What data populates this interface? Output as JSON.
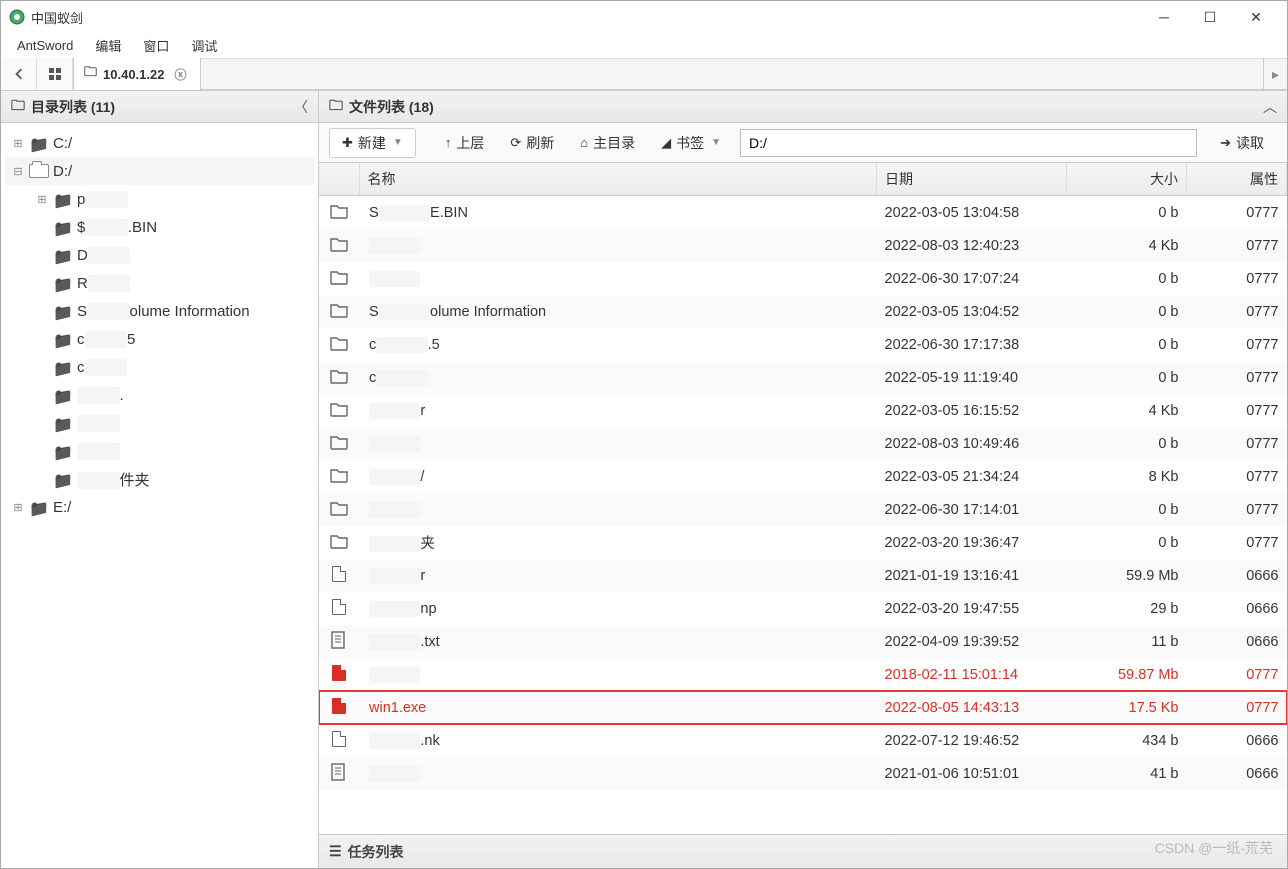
{
  "window": {
    "title": "中国蚁剑"
  },
  "menubar": {
    "items": [
      "AntSword",
      "编辑",
      "窗口",
      "调试"
    ]
  },
  "tabbar": {
    "active_tab": "10.40.1.22"
  },
  "sidebar": {
    "title": "目录列表 (11)",
    "tree": [
      {
        "label": "C:/",
        "icon": "dark",
        "depth": 0
      },
      {
        "label": "D:/",
        "icon": "open",
        "depth": 0,
        "expanded": true,
        "selected": true
      },
      {
        "label": "p███",
        "visible": "p",
        "depth": 1,
        "expandable": true
      },
      {
        "label": "$█████.BIN",
        "visible": "$",
        "tail": ".BIN",
        "depth": 1
      },
      {
        "label": "D███",
        "visible": "D",
        "depth": 1
      },
      {
        "label": "R███",
        "visible": "R",
        "depth": 1
      },
      {
        "label": "S███ Volume Information",
        "visible": "S",
        "tail": "olume Information",
        "depth": 1
      },
      {
        "label": "c████5",
        "visible": "c",
        "tail": "5",
        "depth": 1
      },
      {
        "label": "c███",
        "visible": "c",
        "depth": 1
      },
      {
        "label": "█████.",
        "tail": ".",
        "depth": 1
      },
      {
        "label": "████",
        "depth": 1
      },
      {
        "label": "████",
        "depth": 1
      },
      {
        "label": "███件夹",
        "tail": "件夹",
        "depth": 1
      },
      {
        "label": "E:/",
        "icon": "dark",
        "depth": 0
      }
    ]
  },
  "content": {
    "panel_title": "文件列表 (18)",
    "toolbar": {
      "new": "新建",
      "up": "上层",
      "refresh": "刷新",
      "home": "主目录",
      "bookmark": "书签",
      "path": "D:/",
      "read": "读取"
    },
    "columns": {
      "name": "名称",
      "date": "日期",
      "size": "大小",
      "attr": "属性"
    },
    "rows": [
      {
        "icon": "folder",
        "name": "S███E.BIN",
        "visible": "S",
        "tail": "E.BIN",
        "date": "2022-03-05 13:04:58",
        "size": "0 b",
        "attr": "0777"
      },
      {
        "icon": "folder",
        "name": "████",
        "date": "2022-08-03 12:40:23",
        "size": "4 Kb",
        "attr": "0777",
        "alt": true
      },
      {
        "icon": "folder",
        "name": "████",
        "date": "2022-06-30 17:07:24",
        "size": "0 b",
        "attr": "0777"
      },
      {
        "icon": "folder",
        "name": "S███olume Information",
        "visible": "S",
        "tail": "olume Information",
        "date": "2022-03-05 13:04:52",
        "size": "0 b",
        "attr": "0777",
        "alt": true
      },
      {
        "icon": "folder",
        "name": "c████.5",
        "visible": "c",
        "tail": ".5",
        "date": "2022-06-30 17:17:38",
        "size": "0 b",
        "attr": "0777"
      },
      {
        "icon": "folder",
        "name": "c███",
        "visible": "c",
        "date": "2022-05-19 11:19:40",
        "size": "0 b",
        "attr": "0777",
        "alt": true
      },
      {
        "icon": "folder",
        "name": "████",
        "tail": "r",
        "date": "2022-03-05 16:15:52",
        "size": "4 Kb",
        "attr": "0777"
      },
      {
        "icon": "folder",
        "name": "████",
        "date": "2022-08-03 10:49:46",
        "size": "0 b",
        "attr": "0777",
        "alt": true
      },
      {
        "icon": "folder",
        "name": "████/",
        "tail": "/",
        "date": "2022-03-05 21:34:24",
        "size": "8 Kb",
        "attr": "0777"
      },
      {
        "icon": "folder",
        "name": "████",
        "date": "2022-06-30 17:14:01",
        "size": "0 b",
        "attr": "0777",
        "alt": true
      },
      {
        "icon": "folder",
        "name": "████夹",
        "tail": "夹",
        "date": "2022-03-20 19:36:47",
        "size": "0 b",
        "attr": "0777"
      },
      {
        "icon": "zip",
        "name": "████r",
        "tail": "r",
        "date": "2021-01-19 13:16:41",
        "size": "59.9 Mb",
        "attr": "0666",
        "alt": true
      },
      {
        "icon": "code",
        "name": "████np",
        "tail": "np",
        "date": "2022-03-20 19:47:55",
        "size": "29 b",
        "attr": "0666"
      },
      {
        "icon": "text",
        "name": "████.txt",
        "tail": ".txt",
        "date": "2022-04-09 19:39:52",
        "size": "11 b",
        "attr": "0666",
        "alt": true
      },
      {
        "icon": "file-red",
        "name": "████████",
        "date": "2018-02-11 15:01:14",
        "size": "59.87 Mb",
        "attr": "0777",
        "danger": true
      },
      {
        "icon": "file-red",
        "name": "win1.exe",
        "full": true,
        "date": "2022-08-05 14:43:13",
        "size": "17.5 Kb",
        "attr": "0777",
        "danger": true,
        "boxed": true,
        "alt": true
      },
      {
        "icon": "file",
        "name": "██████████.nk",
        "tail": ".nk",
        "date": "2022-07-12 19:46:52",
        "size": "434 b",
        "attr": "0666"
      },
      {
        "icon": "text",
        "name": "██████",
        "date": "2021-01-06 10:51:01",
        "size": "41 b",
        "attr": "0666",
        "alt": true
      }
    ]
  },
  "taskbar": {
    "title": "任务列表"
  },
  "watermark": "CSDN @一纸-荒芜"
}
